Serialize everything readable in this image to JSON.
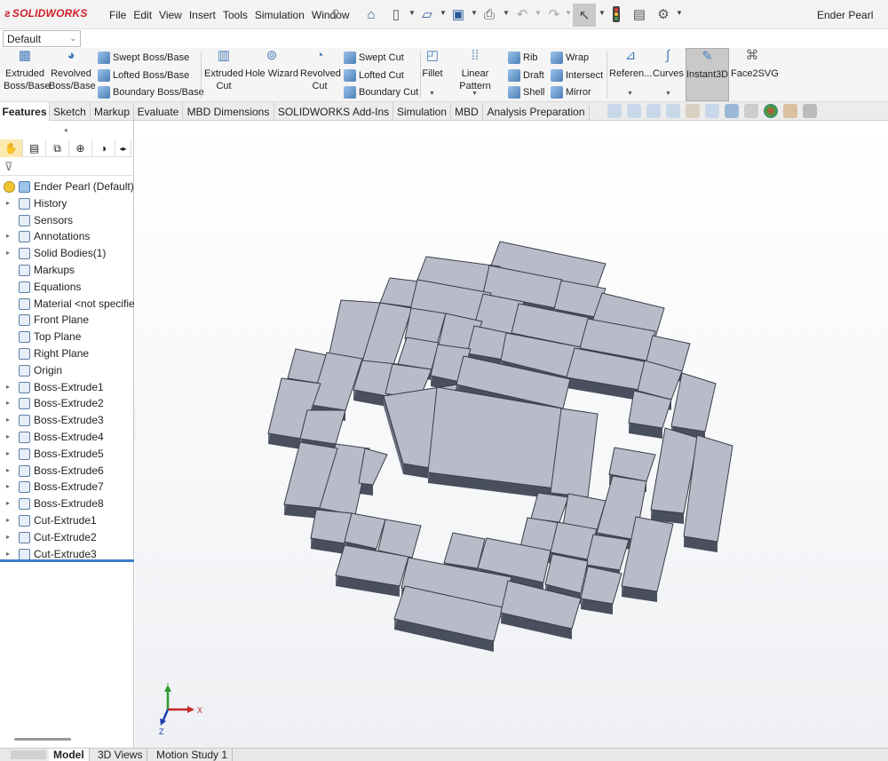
{
  "app": {
    "logo_text": "SOLIDWORKS",
    "document_title": "Ender Pearl"
  },
  "menu": [
    "File",
    "Edit",
    "View",
    "Insert",
    "Tools",
    "Simulation",
    "Window"
  ],
  "configuration": {
    "selected": "Default"
  },
  "ribbon": {
    "extruded_boss": "Extruded Boss/Base",
    "revolved_boss": "Revolved Boss/Base",
    "swept_boss": "Swept Boss/Base",
    "lofted_boss": "Lofted Boss/Base",
    "boundary_boss": "Boundary Boss/Base",
    "extruded_cut": "Extruded Cut",
    "hole_wizard": "Hole Wizard",
    "revolved_cut": "Revolved Cut",
    "swept_cut": "Swept Cut",
    "lofted_cut": "Lofted Cut",
    "boundary_cut": "Boundary Cut",
    "fillet": "Fillet",
    "linear_pattern": "Linear Pattern",
    "rib": "Rib",
    "draft": "Draft",
    "shell": "Shell",
    "wrap": "Wrap",
    "intersect": "Intersect",
    "mirror": "Mirror",
    "reference": "Referen...",
    "curves": "Curves",
    "instant3d": "Instant3D",
    "face2svg": "Face2SVG"
  },
  "tabs": [
    "Features",
    "Sketch",
    "Markup",
    "Evaluate",
    "MBD Dimensions",
    "SOLIDWORKS Add-Ins",
    "Simulation",
    "MBD",
    "Analysis Preparation"
  ],
  "tree": {
    "root": "Ender Pearl (Default) <",
    "items": [
      {
        "label": "History",
        "expandable": true
      },
      {
        "label": "Sensors",
        "expandable": false
      },
      {
        "label": "Annotations",
        "expandable": true
      },
      {
        "label": "Solid Bodies(1)",
        "expandable": true
      },
      {
        "label": "Markups",
        "expandable": false
      },
      {
        "label": "Equations",
        "expandable": false
      },
      {
        "label": "Material <not specified>",
        "expandable": false
      },
      {
        "label": "Front Plane",
        "expandable": false
      },
      {
        "label": "Top Plane",
        "expandable": false
      },
      {
        "label": "Right Plane",
        "expandable": false
      },
      {
        "label": "Origin",
        "expandable": false
      },
      {
        "label": "Boss-Extrude1",
        "expandable": true
      },
      {
        "label": "Boss-Extrude2",
        "expandable": true
      },
      {
        "label": "Boss-Extrude3",
        "expandable": true
      },
      {
        "label": "Boss-Extrude4",
        "expandable": true
      },
      {
        "label": "Boss-Extrude5",
        "expandable": true
      },
      {
        "label": "Boss-Extrude6",
        "expandable": true
      },
      {
        "label": "Boss-Extrude7",
        "expandable": true
      },
      {
        "label": "Boss-Extrude8",
        "expandable": true
      },
      {
        "label": "Cut-Extrude1",
        "expandable": true
      },
      {
        "label": "Cut-Extrude2",
        "expandable": true
      },
      {
        "label": "Cut-Extrude3",
        "expandable": true
      }
    ]
  },
  "triad": {
    "x": "X",
    "y": "Y",
    "z": "Z"
  },
  "bottom_tabs": [
    "Model",
    "3D Views",
    "Motion Study 1"
  ]
}
